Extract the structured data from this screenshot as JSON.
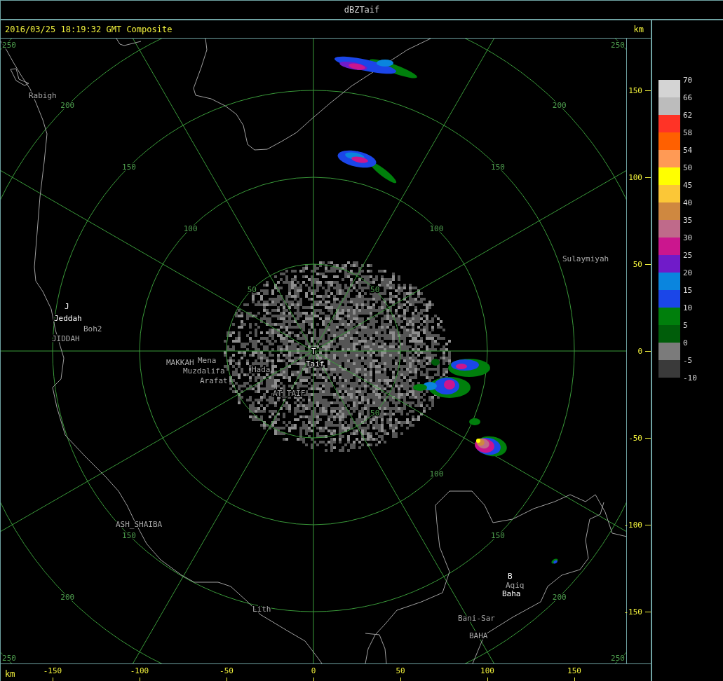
{
  "window": {
    "title": "dBZTaif"
  },
  "header": {
    "timestamp": "2016/03/25 18:19:32 GMT Composite"
  },
  "map": {
    "range_rings": [
      {
        "labels": [
          "50",
          "50",
          "50"
        ]
      },
      {
        "labels": [
          "100",
          "100",
          "100"
        ]
      },
      {
        "labels": [
          "150",
          "150",
          "150",
          "150"
        ]
      },
      {
        "labels": [
          "200",
          "200",
          "200",
          "200"
        ]
      },
      {
        "labels": [
          "250",
          "250",
          "250",
          "250"
        ]
      }
    ],
    "places": [
      {
        "text": "Rabigh",
        "kind": "place"
      },
      {
        "text": "J",
        "kind": "radar_site"
      },
      {
        "text": "Jeddah",
        "kind": "radar_site"
      },
      {
        "text": "Boh2",
        "kind": "place"
      },
      {
        "text": "JIDDAH",
        "kind": "place"
      },
      {
        "text": "MAKKAH",
        "kind": "place"
      },
      {
        "text": "Mena",
        "kind": "place"
      },
      {
        "text": "Muzdalifa",
        "kind": "place"
      },
      {
        "text": "Arafat",
        "kind": "place"
      },
      {
        "text": "Hada",
        "kind": "place"
      },
      {
        "text": "AT_TAIF",
        "kind": "place"
      },
      {
        "text": "T",
        "kind": "radar_site"
      },
      {
        "text": "Taif",
        "kind": "radar_site"
      },
      {
        "text": "Sulaymiyah",
        "kind": "place"
      },
      {
        "text": "ASH_SHAIBA",
        "kind": "place"
      },
      {
        "text": "Lith",
        "kind": "place"
      },
      {
        "text": "B",
        "kind": "radar_site"
      },
      {
        "text": "Aqiq",
        "kind": "place"
      },
      {
        "text": "Baha",
        "kind": "radar_site"
      },
      {
        "text": "Bani-Sar",
        "kind": "place"
      },
      {
        "text": "BAHA",
        "kind": "place"
      }
    ]
  },
  "y_axis": {
    "unit": "km",
    "ticks": [
      "150",
      "100",
      "50",
      "0",
      "-50",
      "-100",
      "-150"
    ]
  },
  "x_axis": {
    "unit": "km",
    "ticks": [
      "-150",
      "-100",
      "-50",
      "0",
      "50",
      "100",
      "150"
    ]
  },
  "legend": {
    "bands": [
      {
        "color": "#d4d4d4"
      },
      {
        "color": "#bcbcbc"
      },
      {
        "color": "#ff3326"
      },
      {
        "color": "#ff6000"
      },
      {
        "color": "#ff9a55"
      },
      {
        "color": "#ffff00"
      },
      {
        "color": "#fbc737"
      },
      {
        "color": "#cf8840"
      },
      {
        "color": "#bf6a8a"
      },
      {
        "color": "#cb168e"
      },
      {
        "color": "#701bc9"
      },
      {
        "color": "#0a85de"
      },
      {
        "color": "#1b46e8"
      },
      {
        "color": "#007f0c"
      },
      {
        "color": "#005d0a"
      },
      {
        "color": "#7b7b7b"
      },
      {
        "color": "#3a3a3a"
      }
    ],
    "labels": [
      "70",
      "66",
      "62",
      "58",
      "54",
      "50",
      "45",
      "40",
      "35",
      "30",
      "25",
      "20",
      "15",
      "10",
      "5",
      "0",
      "-5",
      "-10"
    ]
  }
}
